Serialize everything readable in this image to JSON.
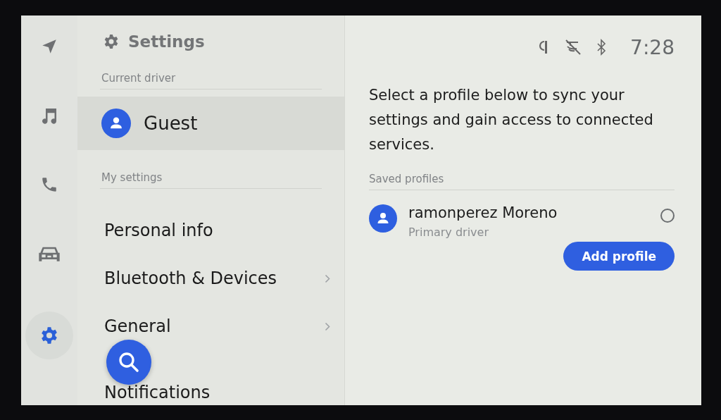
{
  "rail": [
    {
      "kind": "navigation",
      "selected": false
    },
    {
      "kind": "music",
      "selected": false
    },
    {
      "kind": "phone",
      "selected": false
    },
    {
      "kind": "car",
      "selected": false
    },
    {
      "kind": "settings",
      "selected": true
    }
  ],
  "settings_panel": {
    "title": "Settings",
    "current_driver_label": "Current driver",
    "current_driver": "Guest",
    "my_settings_label": "My settings",
    "items": [
      {
        "label": "Personal info",
        "has_arrow": false
      },
      {
        "label": "Bluetooth & Devices",
        "has_arrow": true
      },
      {
        "label": "General",
        "has_arrow": true
      },
      {
        "label": "Notifications",
        "has_arrow": false
      }
    ]
  },
  "status_bar": {
    "icons": [
      {
        "kind": "wireless-charging"
      },
      {
        "kind": "voice-off"
      },
      {
        "kind": "bluetooth"
      }
    ],
    "time": "7:28"
  },
  "profiles": {
    "description": "Select a profile below to sync your settings and gain access to connected services.",
    "saved_label": "Saved profiles",
    "items": [
      {
        "name": "ramonperez Moreno",
        "role": "Primary driver",
        "selected": false
      }
    ],
    "add_button": "Add profile"
  }
}
